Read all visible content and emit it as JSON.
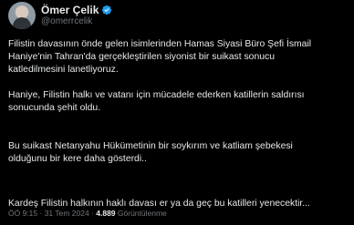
{
  "author": {
    "name": "Ömer Çelik",
    "handle": "@omerrcelik",
    "verified_icon": "verified-badge-icon",
    "verified_color": "#1d9bf0"
  },
  "tweet": {
    "paragraphs": [
      {
        "lines": [
          "Filistin davasının önde gelen isimlerinden Hamas Siyasi Büro Şefi İsmail",
          "Haniye'nin Tahran'da gerçekleştirilen siyonist bir suikast sonucu",
          "katledilmesini lanetliyoruz."
        ]
      },
      {
        "lines": [
          "Haniye, Filistin halkı ve vatanı için mücadele ederken katillerin saldırısı",
          "sonucunda şehit oldu."
        ]
      },
      {
        "lines": [
          "Bu suikast Netanyahu Hükümetinin bir soykırım ve katliam şebekesi",
          "olduğunu bir kere daha gösterdi.."
        ]
      },
      {
        "lines": [
          "Kardeş Filistin halkının haklı davası er ya da geç bu katilleri yenecektir..."
        ]
      }
    ]
  },
  "meta": {
    "time": "ÖÖ 9:15",
    "sep1": " · ",
    "date": "31 Tem 2024",
    "sep2": " · ",
    "views_count": "4.889",
    "views_label": " Görüntülenme"
  },
  "colors": {
    "background": "#000000",
    "text": "#e7e9ea",
    "secondary": "#71767b"
  }
}
